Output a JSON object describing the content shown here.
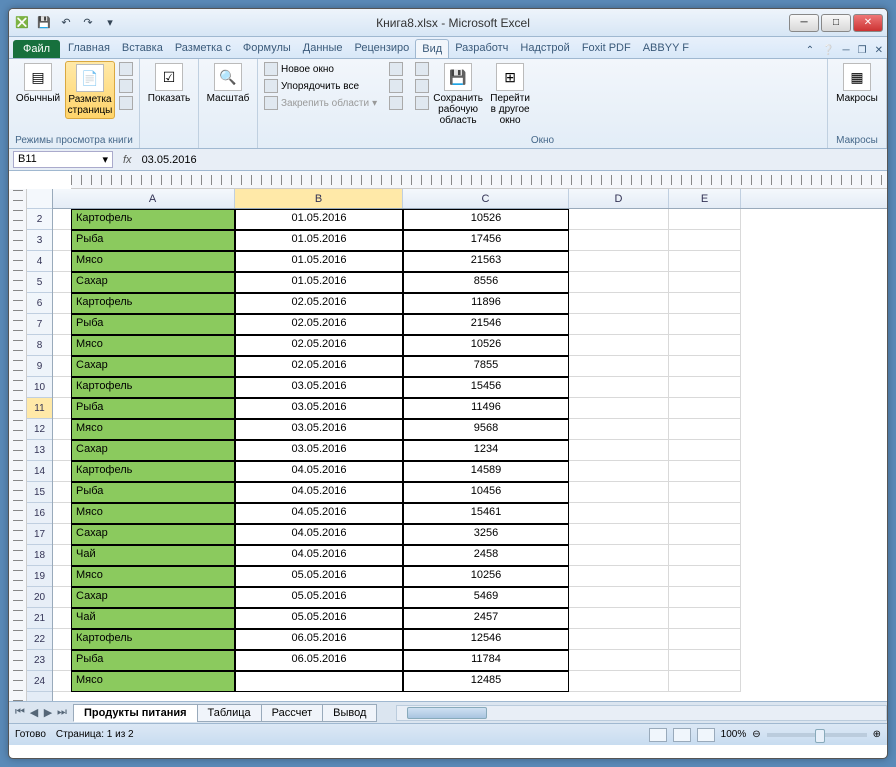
{
  "window": {
    "title": "Книга8.xlsx - Microsoft Excel"
  },
  "ribbon_tabs": {
    "file": "Файл",
    "items": [
      "Главная",
      "Вставка",
      "Разметка с",
      "Формулы",
      "Данные",
      "Рецензиро",
      "Вид",
      "Разработч",
      "Надстрой",
      "Foxit PDF",
      "ABBYY F"
    ],
    "active": "Вид"
  },
  "ribbon": {
    "views": {
      "normal": "Обычный",
      "page_layout": "Разметка страницы",
      "label": "Режимы просмотра книги"
    },
    "show": {
      "button": "Показать"
    },
    "zoom": {
      "button": "Масштаб"
    },
    "window": {
      "new_window": "Новое окно",
      "arrange_all": "Упорядочить все",
      "freeze_panes": "Закрепить области",
      "save_workspace": "Сохранить рабочую область",
      "switch_windows": "Перейти в другое окно",
      "label": "Окно"
    },
    "macros": {
      "button": "Макросы",
      "label": "Макросы"
    }
  },
  "namebox": {
    "ref": "B11",
    "formula": "03.05.2016",
    "fx": "fx"
  },
  "columns": [
    "A",
    "B",
    "C",
    "D",
    "E"
  ],
  "rows": [
    {
      "n": 2,
      "a": "Картофель",
      "b": "01.05.2016",
      "c": "10526"
    },
    {
      "n": 3,
      "a": "Рыба",
      "b": "01.05.2016",
      "c": "17456"
    },
    {
      "n": 4,
      "a": "Мясо",
      "b": "01.05.2016",
      "c": "21563"
    },
    {
      "n": 5,
      "a": "Сахар",
      "b": "01.05.2016",
      "c": "8556"
    },
    {
      "n": 6,
      "a": "Картофель",
      "b": "02.05.2016",
      "c": "11896"
    },
    {
      "n": 7,
      "a": "Рыба",
      "b": "02.05.2016",
      "c": "21546"
    },
    {
      "n": 8,
      "a": "Мясо",
      "b": "02.05.2016",
      "c": "10526"
    },
    {
      "n": 9,
      "a": "Сахар",
      "b": "02.05.2016",
      "c": "7855"
    },
    {
      "n": 10,
      "a": "Картофель",
      "b": "03.05.2016",
      "c": "15456"
    },
    {
      "n": 11,
      "a": "Рыба",
      "b": "03.05.2016",
      "c": "11496"
    },
    {
      "n": 12,
      "a": "Мясо",
      "b": "03.05.2016",
      "c": "9568"
    },
    {
      "n": 13,
      "a": "Сахар",
      "b": "03.05.2016",
      "c": "1234"
    },
    {
      "n": 14,
      "a": "Картофель",
      "b": "04.05.2016",
      "c": "14589"
    },
    {
      "n": 15,
      "a": "Рыба",
      "b": "04.05.2016",
      "c": "10456"
    },
    {
      "n": 16,
      "a": "Мясо",
      "b": "04.05.2016",
      "c": "15461"
    },
    {
      "n": 17,
      "a": "Сахар",
      "b": "04.05.2016",
      "c": "3256"
    },
    {
      "n": 18,
      "a": "Чай",
      "b": "04.05.2016",
      "c": "2458"
    },
    {
      "n": 19,
      "a": "Мясо",
      "b": "05.05.2016",
      "c": "10256"
    },
    {
      "n": 20,
      "a": "Сахар",
      "b": "05.05.2016",
      "c": "5469"
    },
    {
      "n": 21,
      "a": "Чай",
      "b": "05.05.2016",
      "c": "2457"
    },
    {
      "n": 22,
      "a": "Картофель",
      "b": "06.05.2016",
      "c": "12546"
    },
    {
      "n": 23,
      "a": "Рыба",
      "b": "06.05.2016",
      "c": "11784"
    },
    {
      "n": 24,
      "a": "Мясо",
      "b": "",
      "c": "12485"
    }
  ],
  "active_cell": {
    "row": 11,
    "col": "B"
  },
  "sheets": {
    "tabs": [
      "Продукты питания",
      "Таблица",
      "Рассчет",
      "Вывод"
    ],
    "active": 0
  },
  "status": {
    "ready": "Готово",
    "page": "Страница: 1 из 2",
    "zoom": "100%"
  }
}
